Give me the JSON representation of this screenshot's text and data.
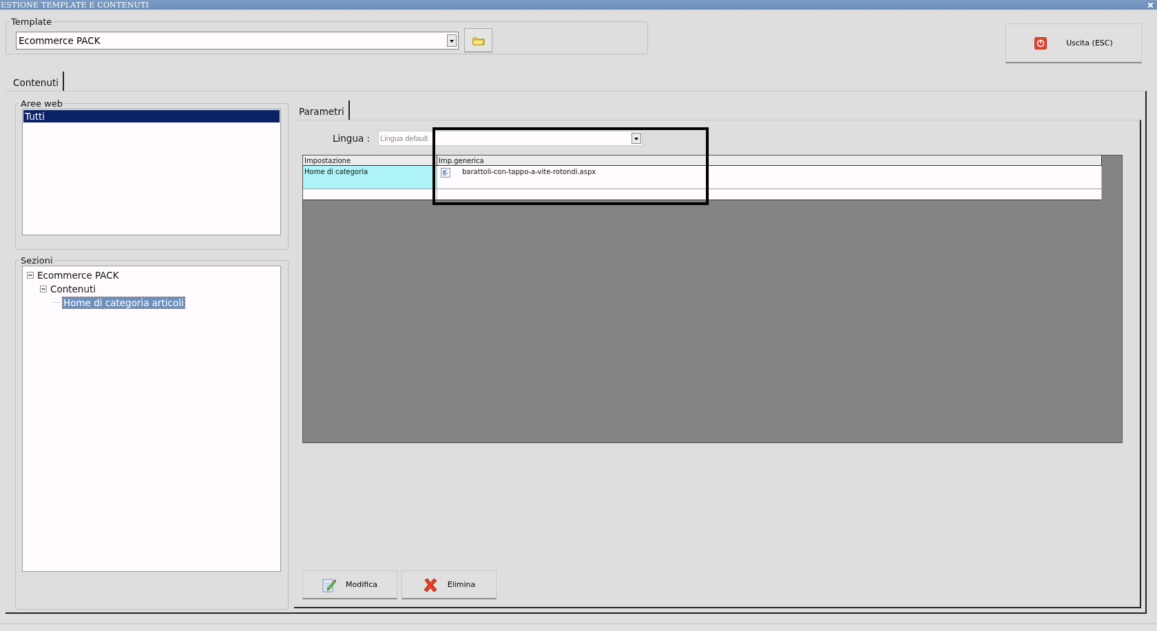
{
  "window": {
    "title": "ESTIONE TEMPLATE E CONTENUTI"
  },
  "template": {
    "title": "Template",
    "value": "Ecommerce PACK"
  },
  "exit_button": {
    "label": "Uscita (ESC)"
  },
  "tabs": [
    {
      "label": "Contenuti",
      "selected": true
    }
  ],
  "aree_web": {
    "title": "Aree web",
    "items": [
      {
        "label": "Tutti",
        "selected": true
      }
    ]
  },
  "sezioni": {
    "title": "Sezioni",
    "tree": [
      {
        "label": "Ecommerce PACK",
        "expanded": true,
        "selected": false,
        "children": [
          {
            "label": "Contenuti",
            "expanded": true,
            "selected": false,
            "children": [
              {
                "label": "Home di categoria articoli",
                "selected": true
              }
            ]
          }
        ]
      }
    ]
  },
  "parametri_tabs": [
    {
      "label": "Parametri",
      "selected": true
    }
  ],
  "lingua": {
    "label": "Lingua :",
    "value": "Lingua default",
    "disabled": true
  },
  "table": {
    "columns": [
      "Impostazione",
      "Imp.generica"
    ],
    "rows": [
      {
        "cells": [
          "Home di categoria",
          "barattoli-con-tappo-a-vite-rotondi.aspx"
        ],
        "selected": true
      }
    ]
  },
  "buttons": [
    {
      "label": "Modifica",
      "kind": "edit"
    },
    {
      "label": "Elimina",
      "kind": "delete"
    }
  ]
}
